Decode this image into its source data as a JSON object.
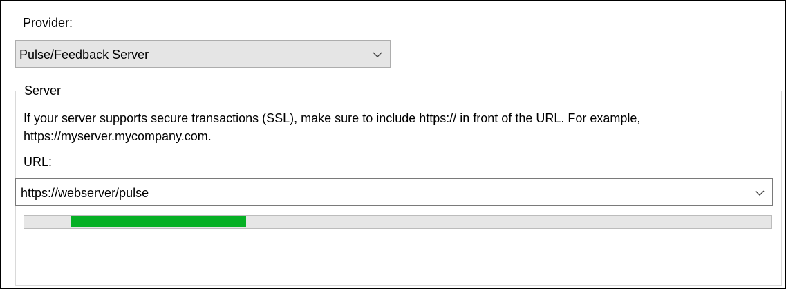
{
  "provider": {
    "label": "Provider:",
    "selected": "Pulse/Feedback Server"
  },
  "server_group": {
    "title": "Server",
    "description": "If your server supports secure transactions (SSL), make sure to include https:// in front of the URL. For example, https://myserver.mycompany.com.",
    "url_label": "URL:",
    "url_value": "https://webserver/pulse",
    "progress": {
      "start_fraction": 0.063,
      "end_fraction": 0.297
    }
  },
  "icons": {
    "dropdown": "chevron-down-icon"
  },
  "colors": {
    "progress_fill": "#06b025",
    "progress_track": "#e6e6e6"
  }
}
